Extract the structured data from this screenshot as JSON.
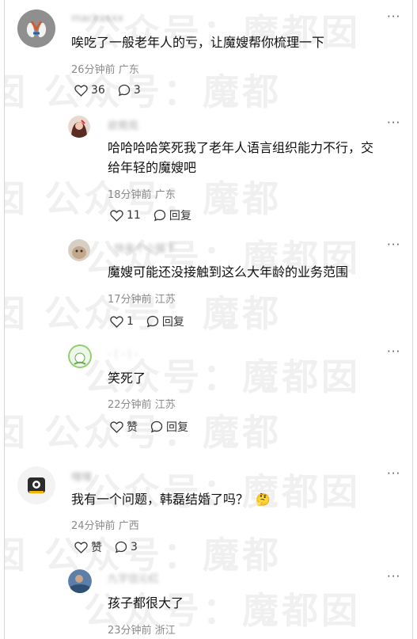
{
  "watermark": {
    "line_a": "公众号：魔都囡",
    "line_b": "囡    公众号：魔都"
  },
  "comments": [
    {
      "name": "mackaxxx",
      "text": "唉吃了一般老年人的亏，让魔嫂帮你梳理一下",
      "time": "26分钟前",
      "location": "广东",
      "likes": "36",
      "replies": "3",
      "more": "···"
    },
    {
      "name": "欲菀苑",
      "text_line1": "哈哈哈哈笑死我了老年人语言组织能力不行，交",
      "text_line2": "给年轻的魔嫂吧",
      "time": "18分钟前",
      "location": "广东",
      "likes": "11",
      "reply_label": "回复",
      "more": "···"
    },
    {
      "name": "· 快来个小猫下",
      "text": "魔嫂可能还没接触到这么大年龄的业务范围",
      "time": "17分钟前",
      "location": "江苏",
      "likes": "1",
      "reply_label": "回复",
      "more": "···"
    },
    {
      "name": "·｜·｜·",
      "text": "笑死了",
      "time": "22分钟前",
      "location": "江苏",
      "likes": "赞",
      "reply_label": "回复",
      "more": "···"
    },
    {
      "name": "嘿嘿",
      "text": "我有一个问题，韩磊结婚了吗？",
      "emoji": "🤔",
      "time": "24分钟前",
      "location": "广西",
      "likes": "赞",
      "replies": "3",
      "more": "···"
    },
    {
      "name": "九宇信沁红",
      "text": "孩子都很大了",
      "time": "23分钟前",
      "location": "浙江",
      "more": "···"
    }
  ]
}
